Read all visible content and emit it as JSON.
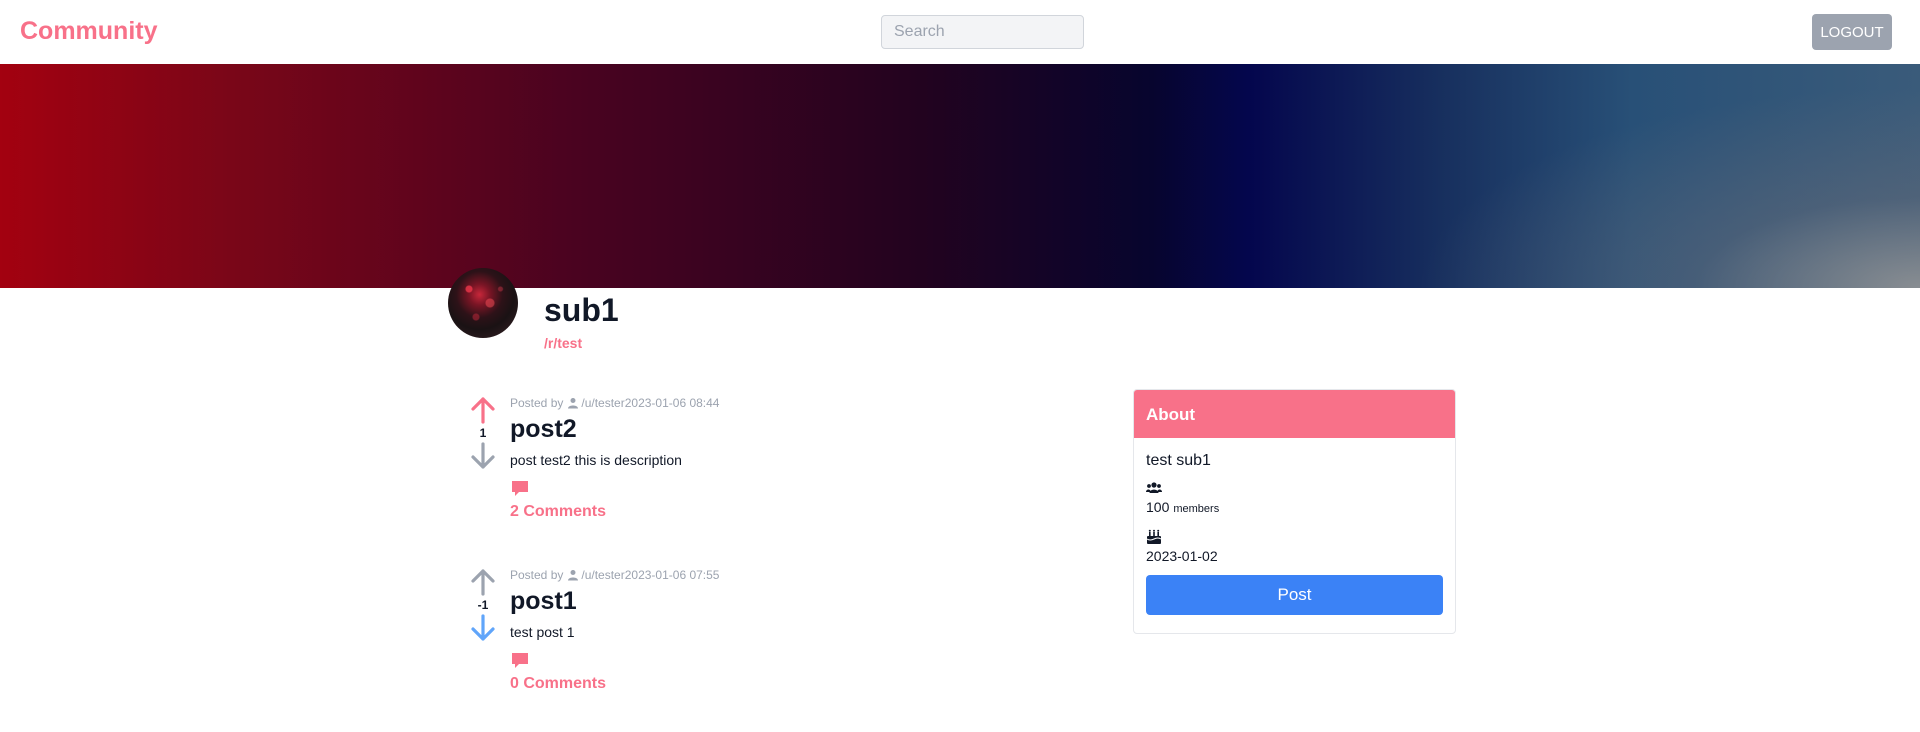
{
  "navbar": {
    "brand": "Community",
    "search_placeholder": "Search",
    "logout_label": "LOGOUT"
  },
  "sub": {
    "name": "sub1",
    "path": "/r/test"
  },
  "posts": [
    {
      "posted_by": "Posted by",
      "user": "/u/tester",
      "date": "2023-01-06 08:44",
      "title": "post2",
      "description": "post test2 this is description",
      "score": "1",
      "vote": "up",
      "comments": "2 Comments"
    },
    {
      "posted_by": "Posted by",
      "user": "/u/tester",
      "date": "2023-01-06 07:55",
      "title": "post1",
      "description": "test post 1",
      "score": "-1",
      "vote": "down",
      "comments": "0 Comments"
    }
  ],
  "about": {
    "heading": "About",
    "description": "test sub1",
    "member_count": "100",
    "member_unit": "members",
    "created": "2023-01-02",
    "post_button": "Post"
  },
  "colors": {
    "brand": "#f87189",
    "upvote_active": "#f87189",
    "downvote_active": "#60a5fa",
    "vote_inactive": "#9ca3af",
    "post_button": "#3b82f6"
  }
}
